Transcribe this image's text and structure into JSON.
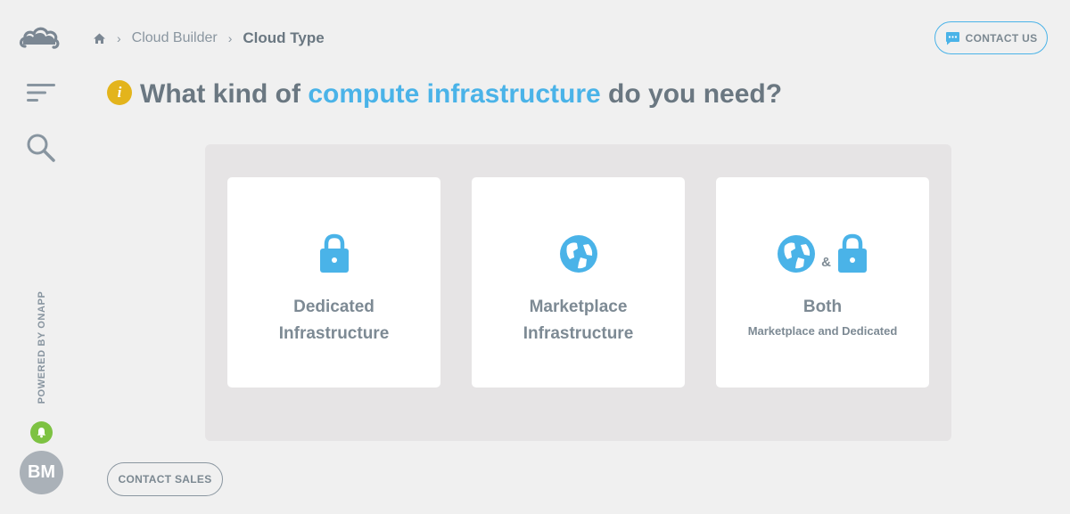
{
  "sidebar": {
    "powered_by": "POWERED BY ONAPP",
    "avatar_initials": "BM"
  },
  "breadcrumb": {
    "items": [
      "Cloud Builder"
    ],
    "current": "Cloud Type"
  },
  "header": {
    "contact_us": "CONTACT US"
  },
  "question": {
    "prefix": "What kind of ",
    "highlight": "compute infrastructure",
    "suffix": " do you need?"
  },
  "options": [
    {
      "title_line1": "Dedicated",
      "title_line2": "Infrastructure",
      "icon": "lock-icon"
    },
    {
      "title_line1": "Marketplace",
      "title_line2": "Infrastructure",
      "icon": "globe-icon"
    },
    {
      "title": "Both",
      "subtitle": "Marketplace and Dedicated",
      "amp": "&",
      "icon": "globe-and-lock-icon"
    }
  ],
  "footer": {
    "contact_sales": "CONTACT SALES"
  },
  "colors": {
    "accent": "#4ab3e8",
    "info": "#e3b41c",
    "notification": "#7dc242",
    "text": "#6a7781",
    "background": "#f0f0f0"
  }
}
